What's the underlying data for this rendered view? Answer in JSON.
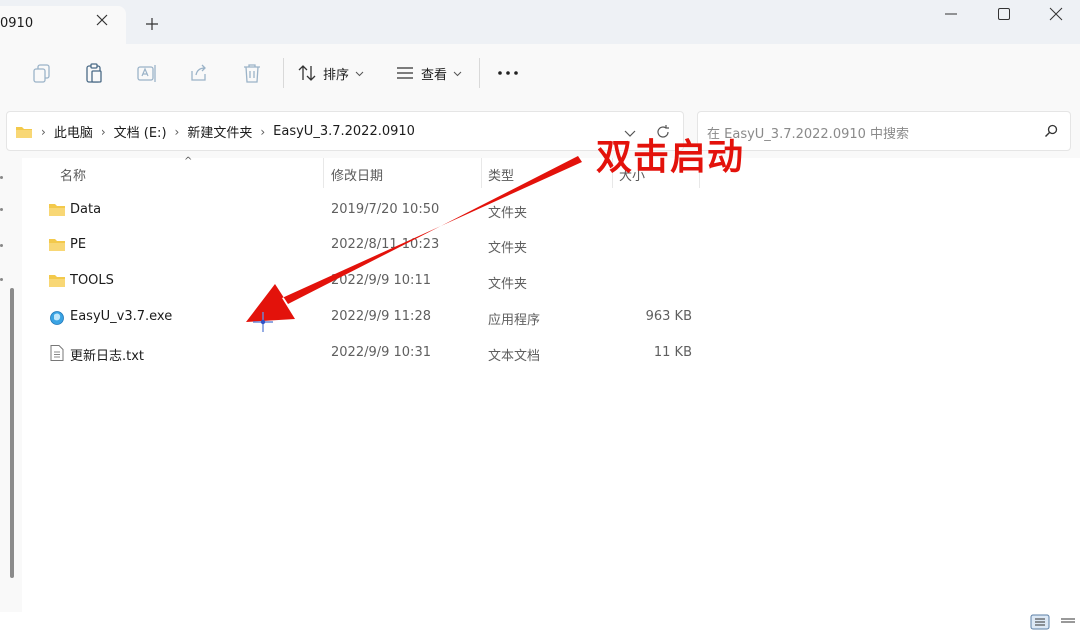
{
  "tab": {
    "title": "0910"
  },
  "toolbar": {
    "sort_label": "排序",
    "view_label": "查看",
    "more_label": "···"
  },
  "breadcrumb": [
    "此电脑",
    "文档 (E:)",
    "新建文件夹",
    "EasyU_3.7.2022.0910"
  ],
  "search": {
    "placeholder": "在 EasyU_3.7.2022.0910 中搜索"
  },
  "columns": {
    "name": "名称",
    "modified": "修改日期",
    "type": "类型",
    "size": "大小"
  },
  "files": [
    {
      "icon": "folder-icon",
      "name": "Data",
      "modified": "2019/7/20 10:50",
      "type": "文件夹",
      "size": ""
    },
    {
      "icon": "folder-icon",
      "name": "PE",
      "modified": "2022/8/11 10:23",
      "type": "文件夹",
      "size": ""
    },
    {
      "icon": "folder-icon",
      "name": "TOOLS",
      "modified": "2022/9/9 10:11",
      "type": "文件夹",
      "size": ""
    },
    {
      "icon": "app-icon",
      "name": "EasyU_v3.7.exe",
      "modified": "2022/9/9 11:28",
      "type": "应用程序",
      "size": "963 KB"
    },
    {
      "icon": "text-file-icon",
      "name": "更新日志.txt",
      "modified": "2022/9/9 10:31",
      "type": "文本文档",
      "size": "11 KB"
    }
  ],
  "annotation": {
    "text": "双击启动",
    "color": "#e3120b"
  },
  "colors": {
    "folder": "#f3c94b",
    "accent": "#0067c0"
  }
}
